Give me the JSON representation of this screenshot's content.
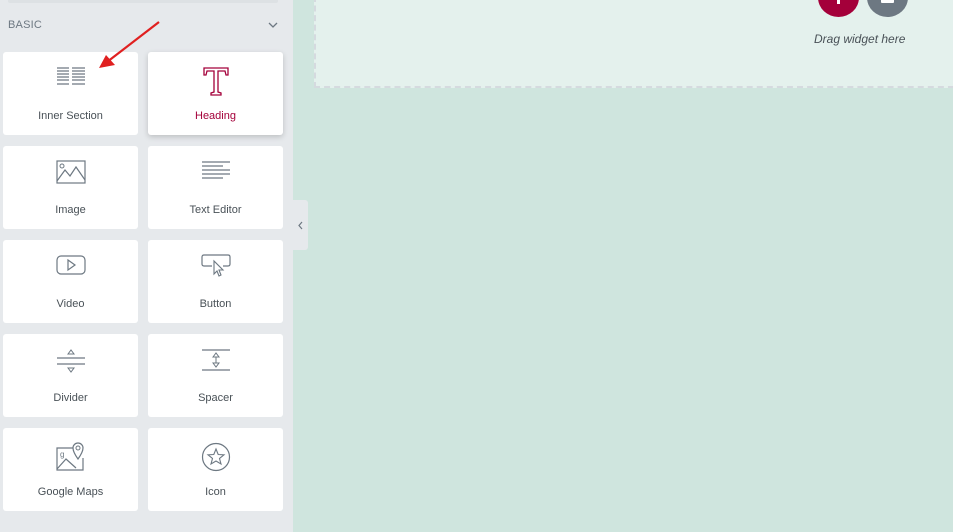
{
  "panel": {
    "category": "BASIC",
    "widgets": [
      {
        "label": "Inner Section",
        "icon": "inner-section-icon"
      },
      {
        "label": "Heading",
        "icon": "heading-icon"
      },
      {
        "label": "Image",
        "icon": "image-icon"
      },
      {
        "label": "Text Editor",
        "icon": "text-editor-icon"
      },
      {
        "label": "Video",
        "icon": "video-icon"
      },
      {
        "label": "Button",
        "icon": "button-icon"
      },
      {
        "label": "Divider",
        "icon": "divider-icon"
      },
      {
        "label": "Spacer",
        "icon": "spacer-icon"
      },
      {
        "label": "Google Maps",
        "icon": "google-maps-icon"
      },
      {
        "label": "Icon",
        "icon": "star-icon"
      }
    ]
  },
  "canvas": {
    "drop_hint": "Drag widget here"
  },
  "colors": {
    "accent": "#a4003a",
    "secondary": "#6d7882",
    "annotation": "#e02020"
  }
}
